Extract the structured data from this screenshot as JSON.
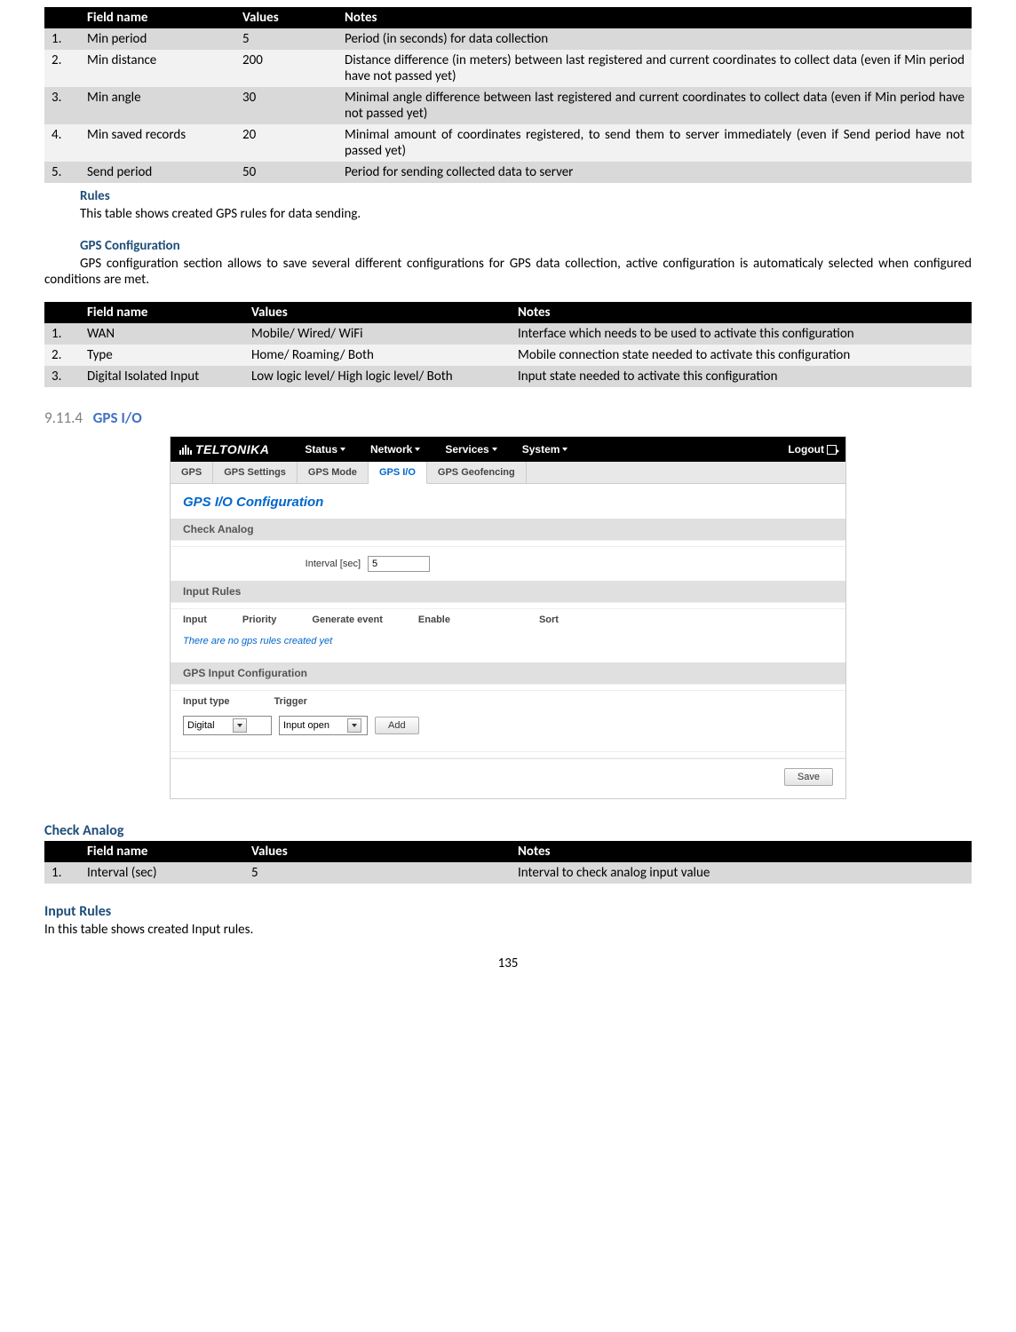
{
  "table1": {
    "headers": [
      "",
      "Field name",
      "Values",
      "Notes"
    ],
    "rows": [
      {
        "n": "1.",
        "f": "Min period",
        "v": "5",
        "notes": "Period (in seconds) for data collection"
      },
      {
        "n": "2.",
        "f": "Min distance",
        "v": "200",
        "notes": "Distance difference (in meters) between last registered and current coordinates to collect data (even if Min period have not passed yet)"
      },
      {
        "n": "3.",
        "f": "Min angle",
        "v": "30",
        "notes": "Minimal angle difference  between last registered and current coordinates to collect data (even if Min period have not passed yet)"
      },
      {
        "n": "4.",
        "f": "Min saved records",
        "v": "20",
        "notes": "Minimal amount of coordinates registered, to send them to server immediately (even if  Send period have not passed yet)"
      },
      {
        "n": "5.",
        "f": "Send period",
        "v": "50",
        "notes": "Period for sending collected data to server"
      }
    ]
  },
  "text": {
    "rules_h": "Rules",
    "rules_p": "This table shows created GPS rules for data sending.",
    "gpsconf_h": "GPS Configuration",
    "gpsconf_p": "GPS configuration section allows to save several different configurations for GPS data collection, active configuration is automaticaly selected when configured conditions are met.",
    "sec_num": "9.11.4",
    "sec_title": "GPS I/O",
    "check_analog_h": "Check Analog",
    "input_rules_h": "Input Rules",
    "input_rules_p": "In this table shows created Input rules.",
    "page": "135"
  },
  "table2": {
    "headers": [
      "",
      "Field name",
      "Values",
      "Notes"
    ],
    "rows": [
      {
        "n": "1.",
        "f": "WAN",
        "v": "Mobile/ Wired/ WiFi",
        "notes": "Interface which needs to be used to activate this configuration"
      },
      {
        "n": "2.",
        "f": "Type",
        "v": "Home/ Roaming/ Both",
        "notes": "Mobile connection state needed to activate this configuration"
      },
      {
        "n": "3.",
        "f": "Digital Isolated Input",
        "v": "Low logic level/ High logic level/ Both",
        "notes": "Input state  needed to activate this  configuration"
      }
    ]
  },
  "table3": {
    "headers": [
      "",
      "Field name",
      "Values",
      "Notes"
    ],
    "rows": [
      {
        "n": "1.",
        "f": "Interval (sec)",
        "v": "5",
        "notes": "Interval to check analog input value"
      }
    ]
  },
  "shot": {
    "brand": "TELTONIKA",
    "nav": {
      "status": "Status",
      "network": "Network",
      "services": "Services",
      "system": "System",
      "logout": "Logout"
    },
    "tabs": {
      "gps": "GPS",
      "settings": "GPS Settings",
      "mode": "GPS Mode",
      "io": "GPS I/O",
      "geo": "GPS Geofencing"
    },
    "title": "GPS I/O Configuration",
    "sections": {
      "check_analog": "Check Analog",
      "input_rules": "Input Rules",
      "gps_input_conf": "GPS Input Configuration"
    },
    "interval_label": "Interval [sec]",
    "interval_value": "5",
    "cols": {
      "input": "Input",
      "priority": "Priority",
      "gen": "Generate event",
      "enable": "Enable",
      "sort": "Sort"
    },
    "empty": "There are no gps rules created yet",
    "labels": {
      "input_type": "Input type",
      "trigger": "Trigger"
    },
    "select": {
      "digital": "Digital",
      "input_open": "Input open"
    },
    "buttons": {
      "add": "Add",
      "save": "Save"
    }
  }
}
